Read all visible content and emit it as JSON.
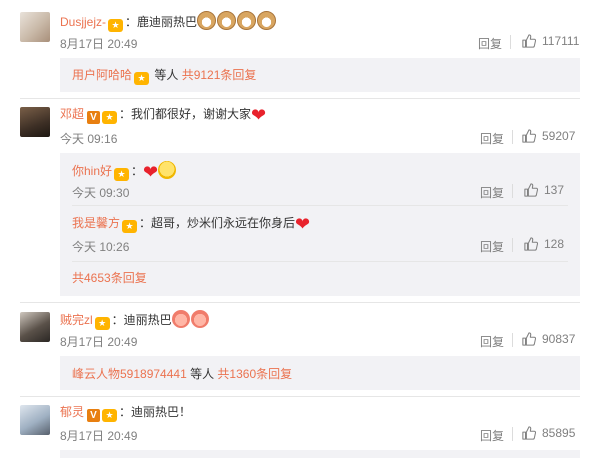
{
  "comments": [
    {
      "name": "Dusjjejz-",
      "text": "：鹿迪丽热巴",
      "emojis": [
        "dog-emoji",
        "dog-emoji",
        "dog-emoji",
        "dog-emoji"
      ],
      "time": "8月17日 20:49",
      "reply": "回复",
      "likes": "117111",
      "sub_summary": {
        "user": "用户阿哈哈",
        "mid": " 等人 ",
        "count": "共9121条回复"
      }
    },
    {
      "name": "邓超",
      "verified": "V",
      "text": "：我们都很好，谢谢大家",
      "time": "今天 09:16",
      "reply": "回复",
      "likes": "59207",
      "replies": [
        {
          "name": "你hin好",
          "text": "：",
          "time": "今天 09:30",
          "reply": "回复",
          "likes": "137"
        },
        {
          "name": "我是馨方",
          "text": "：超哥，炒米们永远在你身后",
          "time": "今天 10:26",
          "reply": "回复",
          "likes": "128"
        }
      ],
      "sub_summary": {
        "count": "共4653条回复"
      }
    },
    {
      "name": "贼完zl",
      "text": "：迪丽热巴",
      "time": "8月17日 20:49",
      "reply": "回复",
      "likes": "90837",
      "sub_summary": {
        "user": "峰云人物5918974441",
        "mid": " 等人 ",
        "count": "共1360条回复"
      }
    },
    {
      "name": "郁灵",
      "verified": "V",
      "text": "：迪丽热巴！",
      "time": "8月17日 20:49",
      "reply": "回复",
      "likes": "85895"
    }
  ],
  "colors": {
    "name": "#eb7350",
    "panel": "#f2f2f5",
    "meta": "#808080"
  }
}
